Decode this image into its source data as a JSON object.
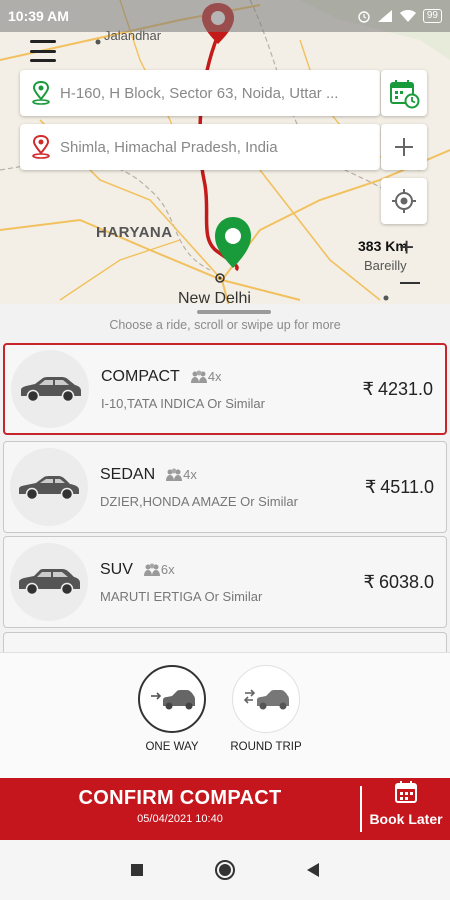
{
  "status_bar": {
    "time": "10:39 AM",
    "battery": "99"
  },
  "map": {
    "place_labels": [
      "Jalandhar",
      "HARYANA",
      "New Delhi",
      "Bareilly"
    ],
    "distance": "383 Km"
  },
  "pickup": {
    "value": "H-160, H Block, Sector 63, Noida, Uttar ..."
  },
  "dropoff": {
    "value": "Shimla, Himachal Pradesh, India"
  },
  "panel": {
    "hint": "Choose a ride, scroll or swipe up for more"
  },
  "rides": [
    {
      "name": "COMPACT",
      "seats": "4x",
      "desc": "I-10,TATA INDICA Or Similar",
      "price": "4231.0"
    },
    {
      "name": "SEDAN",
      "seats": "4x",
      "desc": "DZIER,HONDA AMAZE Or Similar",
      "price": "4511.0"
    },
    {
      "name": "SUV",
      "seats": "6x",
      "desc": "MARUTI ERTIGA  Or Similar",
      "price": "6038.0"
    }
  ],
  "currency_symbol": "₹",
  "trip_types": {
    "one_way": "ONE WAY",
    "round_trip": "ROUND TRIP"
  },
  "confirm": {
    "title": "CONFIRM COMPACT",
    "datetime": "05/04/2021 10:40",
    "book_later": "Book Later"
  },
  "colors": {
    "brand_red": "#c4161c",
    "pickup_green": "#1a9b3b",
    "route_red": "#c41a1a"
  }
}
